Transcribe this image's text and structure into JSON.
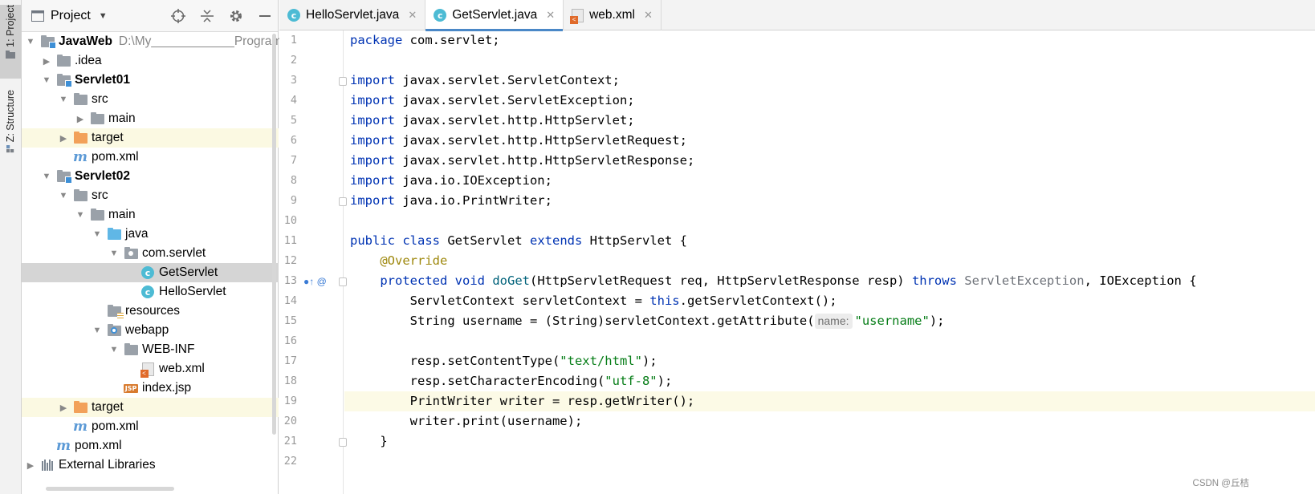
{
  "left_strip": {
    "project_tab": "1: Project",
    "structure_tab": "Z: Structure"
  },
  "project_panel": {
    "title": "Project",
    "tree": [
      {
        "label": "JavaWeb",
        "hint": "D:\\My____________Program"
      },
      {
        "label": ".idea"
      },
      {
        "label": "Servlet01"
      },
      {
        "label": "src"
      },
      {
        "label": "main"
      },
      {
        "label": "target"
      },
      {
        "label": "pom.xml"
      },
      {
        "label": "Servlet02"
      },
      {
        "label": "src"
      },
      {
        "label": "main"
      },
      {
        "label": "java"
      },
      {
        "label": "com.servlet"
      },
      {
        "label": "GetServlet"
      },
      {
        "label": "HelloServlet"
      },
      {
        "label": "resources"
      },
      {
        "label": "webapp"
      },
      {
        "label": "WEB-INF"
      },
      {
        "label": "web.xml"
      },
      {
        "label": "index.jsp"
      },
      {
        "label": "target"
      },
      {
        "label": "pom.xml"
      },
      {
        "label": "pom.xml"
      },
      {
        "label": "External Libraries"
      }
    ]
  },
  "tabs": [
    {
      "label": "HelloServlet.java",
      "icon": "class-icon"
    },
    {
      "label": "GetServlet.java",
      "icon": "class-icon"
    },
    {
      "label": "web.xml",
      "icon": "xml-icon"
    }
  ],
  "active_tab": "GetServlet.java",
  "editor": {
    "line_numbers": [
      "1",
      "2",
      "3",
      "4",
      "5",
      "6",
      "7",
      "8",
      "9",
      "10",
      "11",
      "12",
      "13",
      "14",
      "15",
      "16",
      "17",
      "18",
      "19",
      "20",
      "21",
      "22"
    ],
    "current_line": "19",
    "line13_marks": "●↑ @",
    "code": {
      "l1": {
        "kw": "package",
        "rest": " com.servlet;"
      },
      "l3": {
        "kw": "import",
        "rest": " javax.servlet.ServletContext;"
      },
      "l4": {
        "kw": "import",
        "rest": " javax.servlet.ServletException;"
      },
      "l5": {
        "kw": "import",
        "rest": " javax.servlet.http.HttpServlet;"
      },
      "l6": {
        "kw": "import",
        "rest": " javax.servlet.http.HttpServletRequest;"
      },
      "l7": {
        "kw": "import",
        "rest": " javax.servlet.http.HttpServletResponse;"
      },
      "l8": {
        "kw": "import",
        "rest": " java.io.IOException;"
      },
      "l9": {
        "kw": "import",
        "rest": " java.io.PrintWriter;"
      },
      "l11": {
        "kw1": "public",
        "kw2": "class",
        "name": " GetServlet ",
        "kw3": "extends",
        "rest": " HttpServlet {"
      },
      "l12": {
        "ann": "@Override"
      },
      "l13": {
        "kw1": "protected",
        "kw2": "void",
        "fn": "doGet",
        "params": "(HttpServletRequest req, HttpServletResponse resp) ",
        "kw3": "throws",
        "gray": " ServletException",
        "rest": ", IOException {"
      },
      "l14": {
        "a": "ServletContext servletContext = ",
        "kw": "this",
        "b": ".getServletContext();"
      },
      "l15": {
        "a": "String username = (String)servletContext.getAttribute(",
        "hint": "name:",
        "str": "\"username\"",
        "b": ");"
      },
      "l17": {
        "a": "resp.setContentType(",
        "str": "\"text/html\"",
        "b": ");"
      },
      "l18": {
        "a": "resp.setCharacterEncoding(",
        "str": "\"utf-8\"",
        "b": ");"
      },
      "l19": {
        "a": "PrintWriter writer = resp.getWriter();"
      },
      "l20": {
        "a": "writer.print(username);"
      },
      "l21": {
        "a": "}"
      }
    }
  },
  "watermark": "CSDN @丘桔",
  "colors": {
    "keyword": "#0033b3",
    "annotation": "#9e880d",
    "string": "#067d17",
    "selection": "#d5d5d5",
    "excluded_folder_bg": "#fbf9e2",
    "active_tab_underline": "#4a88c7"
  }
}
